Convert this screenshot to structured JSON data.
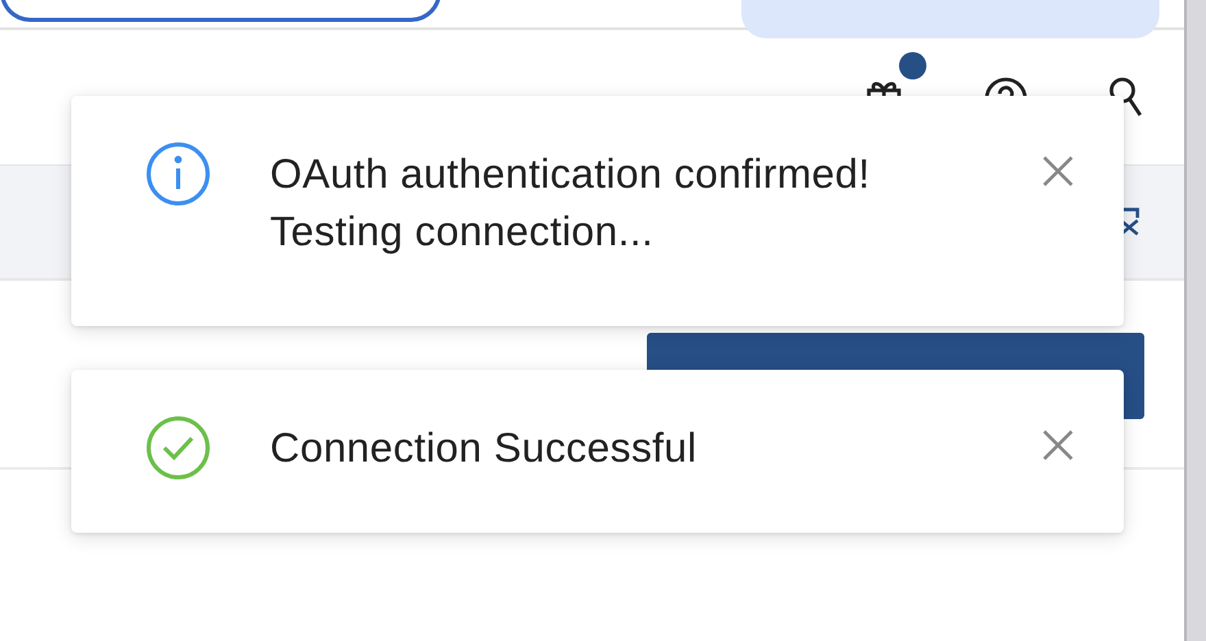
{
  "toasts": [
    {
      "kind": "info",
      "title": "OAuth authentication confirmed!",
      "body": "Testing connection..."
    },
    {
      "kind": "success",
      "title": "Connection Successful"
    }
  ]
}
